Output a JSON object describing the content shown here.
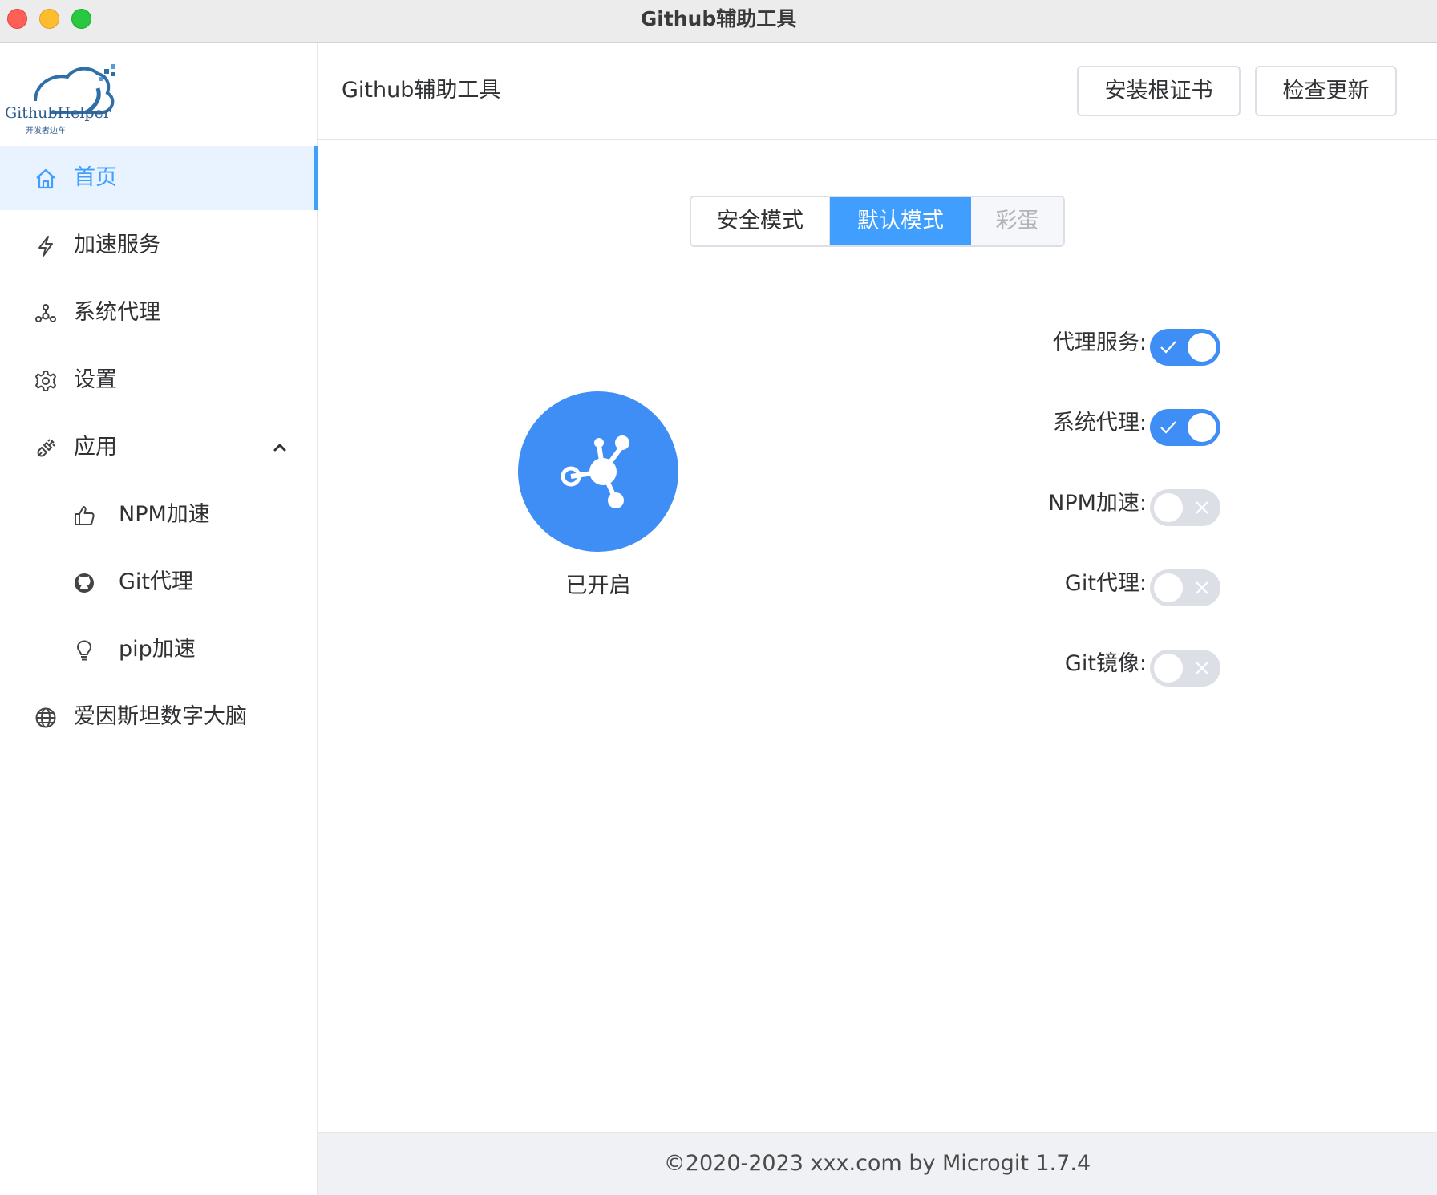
{
  "window": {
    "title": "Github辅助工具"
  },
  "logo": {
    "text": "GithubHelper",
    "subtitle": "开发者边车"
  },
  "sidebar": {
    "items": [
      {
        "label": "首页",
        "icon": "home-icon",
        "active": true
      },
      {
        "label": "加速服务",
        "icon": "lightning-icon"
      },
      {
        "label": "系统代理",
        "icon": "network-icon"
      },
      {
        "label": "设置",
        "icon": "gear-icon"
      },
      {
        "label": "应用",
        "icon": "plug-icon",
        "expanded": true
      },
      {
        "label": "NPM加速",
        "icon": "thumbs-up-icon"
      },
      {
        "label": "Git代理",
        "icon": "github-icon"
      },
      {
        "label": "pip加速",
        "icon": "lightbulb-icon"
      },
      {
        "label": "爱因斯坦数字大脑",
        "icon": "globe-icon"
      }
    ]
  },
  "header": {
    "title": "Github辅助工具",
    "install_cert_label": "安装根证书",
    "check_update_label": "检查更新"
  },
  "modes": {
    "options": [
      "安全模式",
      "默认模式",
      "彩蛋"
    ],
    "selected": "默认模式"
  },
  "status": {
    "label": "已开启",
    "icon": "network-hub-icon"
  },
  "switches": [
    {
      "label": "代理服务:",
      "on": true
    },
    {
      "label": "系统代理:",
      "on": true
    },
    {
      "label": "NPM加速:",
      "on": false
    },
    {
      "label": "Git代理:",
      "on": false
    },
    {
      "label": "Git镜像:",
      "on": false
    }
  ],
  "footer": {
    "text": "©2020-2023 xxx.com by Microgit 1.7.4"
  },
  "colors": {
    "accent": "#409eff",
    "switch_on": "#3f8ef5",
    "switch_off": "#dcdfe6"
  }
}
